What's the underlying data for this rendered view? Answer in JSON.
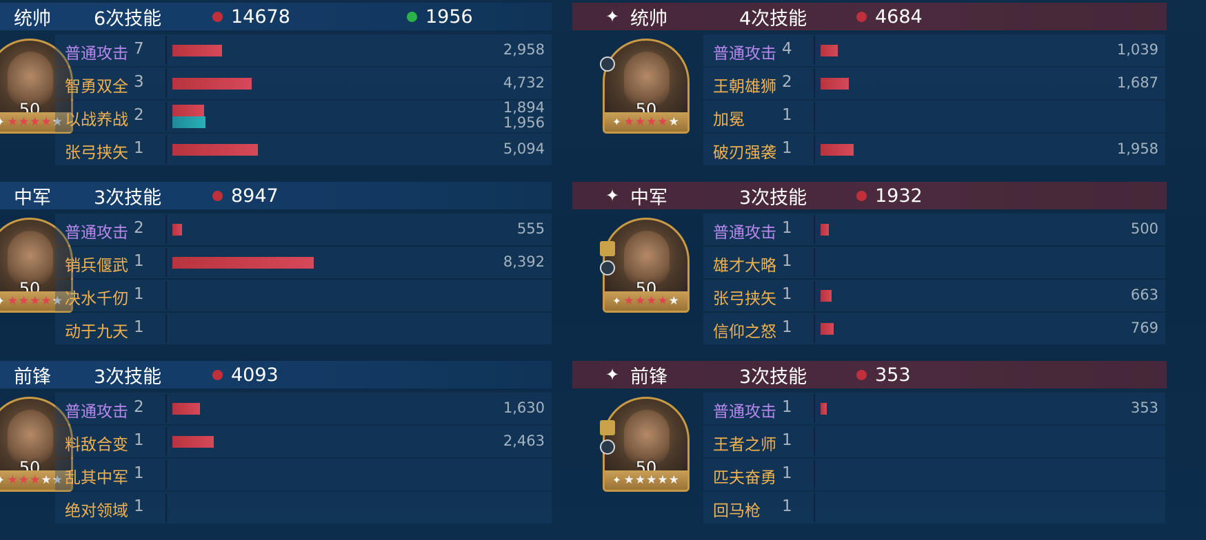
{
  "colors": {
    "damage": "#c0303a",
    "heal": "#2bb34a",
    "basic_attack_label": "#b888ef",
    "skill_label": "#f0b14e",
    "left_header": "#174070",
    "right_header": "#47283a"
  },
  "left": {
    "sections": [
      {
        "role": "统帅",
        "skill_count": "6次技能",
        "damage": "14678",
        "heal": "1956",
        "level": "50",
        "rows": [
          {
            "name": "普通攻击",
            "times": "7",
            "value": "2,958",
            "damage": 2958
          },
          {
            "name": "智勇双全",
            "times": "3",
            "value": "4,732",
            "damage": 4732
          },
          {
            "name": "以战养战",
            "times": "2",
            "value": "1,894",
            "value2": "1,956",
            "damage": 1894,
            "heal": 1956
          },
          {
            "name": "张弓挟矢",
            "times": "1",
            "value": "5,094",
            "damage": 5094
          }
        ]
      },
      {
        "role": "中军",
        "skill_count": "3次技能",
        "damage": "8947",
        "level": "50",
        "rows": [
          {
            "name": "普通攻击",
            "times": "2",
            "value": "555",
            "damage": 555
          },
          {
            "name": "销兵偃武",
            "times": "1",
            "value": "8,392",
            "damage": 8392
          },
          {
            "name": "决水千仞",
            "times": "1",
            "value": ""
          },
          {
            "name": "动于九天",
            "times": "1",
            "value": ""
          }
        ]
      },
      {
        "role": "前锋",
        "skill_count": "3次技能",
        "damage": "4093",
        "level": "50",
        "rows": [
          {
            "name": "普通攻击",
            "times": "2",
            "value": "1,630",
            "damage": 1630
          },
          {
            "name": "料敌合变",
            "times": "1",
            "value": "2,463",
            "damage": 2463
          },
          {
            "name": "乱其中军",
            "times": "1",
            "value": ""
          },
          {
            "name": "绝对领域",
            "times": "1",
            "value": ""
          }
        ]
      }
    ]
  },
  "right": {
    "sections": [
      {
        "role": "统帅",
        "skill_count": "4次技能",
        "damage": "4684",
        "level": "50",
        "rows": [
          {
            "name": "普通攻击",
            "times": "4",
            "value": "1,039",
            "damage": 1039
          },
          {
            "name": "王朝雄狮",
            "times": "2",
            "value": "1,687",
            "damage": 1687
          },
          {
            "name": "加冕",
            "times": "1",
            "value": ""
          },
          {
            "name": "破刃强袭",
            "times": "1",
            "value": "1,958",
            "damage": 1958
          }
        ]
      },
      {
        "role": "中军",
        "skill_count": "3次技能",
        "damage": "1932",
        "level": "50",
        "rows": [
          {
            "name": "普通攻击",
            "times": "1",
            "value": "500",
            "damage": 500
          },
          {
            "name": "雄才大略",
            "times": "1",
            "value": ""
          },
          {
            "name": "张弓挟矢",
            "times": "1",
            "value": "663",
            "damage": 663
          },
          {
            "name": "信仰之怒",
            "times": "1",
            "value": "769",
            "damage": 769
          }
        ]
      },
      {
        "role": "前锋",
        "skill_count": "3次技能",
        "damage": "353",
        "level": "50",
        "rows": [
          {
            "name": "普通攻击",
            "times": "1",
            "value": "353",
            "damage": 353
          },
          {
            "name": "王者之师",
            "times": "1",
            "value": ""
          },
          {
            "name": "匹夫奋勇",
            "times": "1",
            "value": ""
          },
          {
            "name": "回马枪",
            "times": "1",
            "value": ""
          }
        ]
      }
    ]
  },
  "stars": {
    "left": [
      4,
      4,
      3
    ],
    "right": [
      4,
      4,
      0
    ]
  },
  "icons": {
    "header_marker": "sparkle-icon",
    "damage_dot": "red-dot-icon",
    "heal_dot": "green-dot-icon",
    "cavalry_badge": "tank-icon",
    "helmet_badge": "helmet-icon"
  }
}
